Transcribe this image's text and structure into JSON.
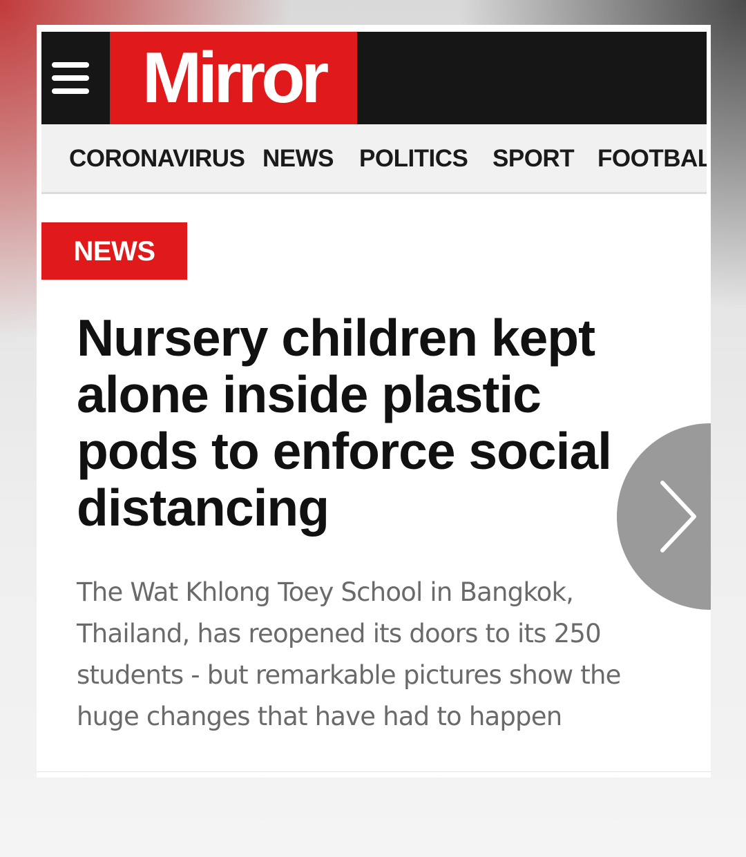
{
  "header": {
    "logo_text": "Mirror",
    "menu_icon": "hamburger-menu-icon",
    "brand_color": "#e01a1a",
    "bar_color": "#161616"
  },
  "nav": {
    "items": [
      {
        "label": "CORONAVIRUS"
      },
      {
        "label": "NEWS"
      },
      {
        "label": "POLITICS"
      },
      {
        "label": "SPORT"
      },
      {
        "label": "FOOTBALL"
      }
    ]
  },
  "article": {
    "section_tag": "NEWS",
    "headline": "Nursery children kept alone inside plastic pods to enforce social distancing",
    "standfirst": "The Wat Khlong Toey School in Bangkok, Thailand, has reopened its doors to its 250 students - but remarkable pictures show the huge changes that have had to happen"
  },
  "controls": {
    "next_icon": "chevron-right-icon"
  }
}
